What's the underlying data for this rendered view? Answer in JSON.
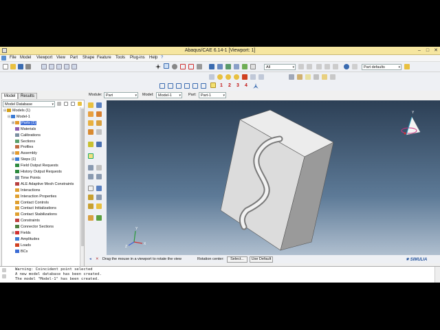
{
  "window": {
    "title": "Abaqus/CAE 6.14-1 [Viewport: 1]"
  },
  "menu": [
    "File",
    "Model",
    "Viewport",
    "View",
    "Part",
    "Shape",
    "Feature",
    "Tools",
    "Plug-ins",
    "Help"
  ],
  "toolbar": {
    "filter_value": "All",
    "defaults_value": "Part defaults",
    "numbers": [
      "1",
      "2",
      "3",
      "4"
    ]
  },
  "context": {
    "module_label": "Module:",
    "module_value": "Part",
    "model_label": "Model:",
    "model_value": "Model-1",
    "part_label": "Part:",
    "part_value": "Part-1"
  },
  "tabs": {
    "model": "Model",
    "results": "Results"
  },
  "tree": {
    "root": "Model Database",
    "items": [
      {
        "label": "Models (1)",
        "indent": 0,
        "exp": "⊟",
        "color": "#d4a017"
      },
      {
        "label": "Model-1",
        "indent": 1,
        "exp": "⊟",
        "color": "#3a7bd5"
      },
      {
        "label": "Parts (1)",
        "indent": 2,
        "exp": "⊞",
        "color": "#e39a2c",
        "selected": true
      },
      {
        "label": "Materials",
        "indent": 2,
        "exp": "",
        "color": "#8e5bb0"
      },
      {
        "label": "Calibrations",
        "indent": 2,
        "exp": "",
        "color": "#7a8fa0"
      },
      {
        "label": "Sections",
        "indent": 2,
        "exp": "",
        "color": "#5aa06a"
      },
      {
        "label": "Profiles",
        "indent": 2,
        "exp": "",
        "color": "#c06a40"
      },
      {
        "label": "Assembly",
        "indent": 2,
        "exp": "⊞",
        "color": "#e39a2c"
      },
      {
        "label": "Steps (1)",
        "indent": 2,
        "exp": "⊞",
        "color": "#3a7bd5"
      },
      {
        "label": "Field Output Requests",
        "indent": 2,
        "exp": "",
        "color": "#2d8a3e"
      },
      {
        "label": "History Output Requests",
        "indent": 2,
        "exp": "",
        "color": "#2d8a3e"
      },
      {
        "label": "Time Points",
        "indent": 2,
        "exp": "",
        "color": "#7a8fa0"
      },
      {
        "label": "ALE Adaptive Mesh Constraints",
        "indent": 2,
        "exp": "",
        "color": "#b84040"
      },
      {
        "label": "Interactions",
        "indent": 2,
        "exp": "",
        "color": "#e0a030"
      },
      {
        "label": "Interaction Properties",
        "indent": 2,
        "exp": "",
        "color": "#e0a030"
      },
      {
        "label": "Contact Controls",
        "indent": 2,
        "exp": "",
        "color": "#e0a030"
      },
      {
        "label": "Contact Initializations",
        "indent": 2,
        "exp": "",
        "color": "#e0a030"
      },
      {
        "label": "Contact Stabilizations",
        "indent": 2,
        "exp": "",
        "color": "#e0a030"
      },
      {
        "label": "Constraints",
        "indent": 2,
        "exp": "",
        "color": "#c04040"
      },
      {
        "label": "Connector Sections",
        "indent": 2,
        "exp": "",
        "color": "#508040"
      },
      {
        "label": "Fields",
        "indent": 2,
        "exp": "⊞",
        "color": "#d03030"
      },
      {
        "label": "Amplitudes",
        "indent": 2,
        "exp": "",
        "color": "#3a7bd5"
      },
      {
        "label": "Loads",
        "indent": 2,
        "exp": "",
        "color": "#d04020"
      },
      {
        "label": "BCs",
        "indent": 2,
        "exp": "",
        "color": "#3a6bd5"
      }
    ]
  },
  "prompt": {
    "text": "Drag the mouse in a viewport to rotate the view",
    "rotation_label": "Rotation center:",
    "select_btn": "Select...",
    "default_btn": "Use Default"
  },
  "brand": "SIMULIA",
  "triad": {
    "x": "X",
    "y": "Y",
    "z": "Z"
  },
  "messages": [
    "Warning: Coincident point selected",
    "A new model database has been created.",
    "The model \"Model-1\" has been created."
  ]
}
